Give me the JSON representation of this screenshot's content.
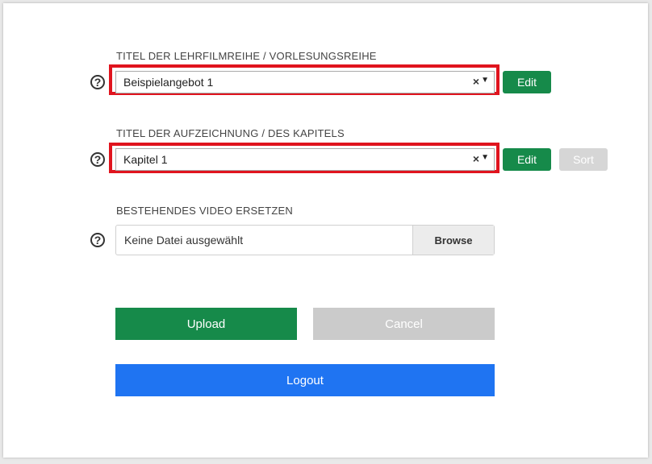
{
  "series_section": {
    "label": "TITEL DER LEHRFILMREIHE / VORLESUNGSREIHE",
    "selected": "Beispielangebot 1",
    "clear_glyph": "×",
    "arrow_glyph": "▼",
    "edit_label": "Edit"
  },
  "chapter_section": {
    "label": "TITEL DER AUFZEICHNUNG / DES KAPITELS",
    "selected": "Kapitel 1",
    "clear_glyph": "×",
    "arrow_glyph": "▼",
    "edit_label": "Edit",
    "sort_label": "Sort"
  },
  "replace_section": {
    "label": "BESTEHENDES VIDEO ERSETZEN",
    "file_status": "Keine Datei ausgewählt",
    "browse_label": "Browse"
  },
  "help_glyph": "?",
  "actions": {
    "upload_label": "Upload",
    "cancel_label": "Cancel",
    "logout_label": "Logout"
  },
  "colors": {
    "highlight": "#e0141e",
    "green": "#168a4a",
    "blue": "#1f74f2",
    "disabled": "#cbcbcb"
  }
}
